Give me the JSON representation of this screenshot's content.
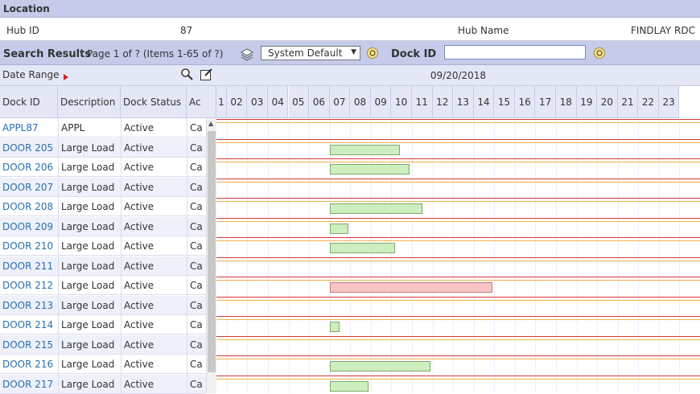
{
  "location": {
    "header": "Location"
  },
  "hub": {
    "id_label": "Hub ID",
    "id_value": "87",
    "name_label": "Hub Name",
    "name_value": "FINDLAY RDC"
  },
  "search": {
    "title": "Search Results",
    "page_info": "Page 1 of ? (Items 1-65 of ?)",
    "view_select": "System Default",
    "dock_id_label": "Dock ID",
    "dock_id_value": ""
  },
  "daterange": {
    "label": "Date Range",
    "date": "09/20/2018"
  },
  "columns": {
    "dock_id": "Dock ID",
    "description": "Description",
    "dock_status": "Dock Status",
    "ac": "Ac"
  },
  "hours": [
    "1",
    "02",
    "03",
    "04",
    "05",
    "06",
    "07",
    "08",
    "09",
    "10",
    "11",
    "12",
    "13",
    "14",
    "15",
    "16",
    "17",
    "18",
    "19",
    "20",
    "21",
    "22",
    "23"
  ],
  "rows": [
    {
      "id": "APPL87",
      "desc": "APPL",
      "status": "Active",
      "ac": "Ca"
    },
    {
      "id": "DOOR 205",
      "desc": "Large Load",
      "status": "Active",
      "ac": "Ca"
    },
    {
      "id": "DOOR 206",
      "desc": "Large Load",
      "status": "Active",
      "ac": "Ca"
    },
    {
      "id": "DOOR 207",
      "desc": "Large Load",
      "status": "Active",
      "ac": "Ca"
    },
    {
      "id": "DOOR 208",
      "desc": "Large Load",
      "status": "Active",
      "ac": "Ca"
    },
    {
      "id": "DOOR 209",
      "desc": "Large Load",
      "status": "Active",
      "ac": "Ca"
    },
    {
      "id": "DOOR 210",
      "desc": "Large Load",
      "status": "Active",
      "ac": "Ca"
    },
    {
      "id": "DOOR 211",
      "desc": "Large Load",
      "status": "Active",
      "ac": "Ca"
    },
    {
      "id": "DOOR 212",
      "desc": "Large Load",
      "status": "Active",
      "ac": "Ca"
    },
    {
      "id": "DOOR 213",
      "desc": "Large Load",
      "status": "Active",
      "ac": "Ca"
    },
    {
      "id": "DOOR 214",
      "desc": "Large Load",
      "status": "Active",
      "ac": "Ca"
    },
    {
      "id": "DOOR 215",
      "desc": "Large Load",
      "status": "Active",
      "ac": "Ca"
    },
    {
      "id": "DOOR 216",
      "desc": "Large Load",
      "status": "Active",
      "ac": "Ca"
    },
    {
      "id": "DOOR 217",
      "desc": "Large Load",
      "status": "Active",
      "ac": "Ca"
    }
  ],
  "colors": {
    "accent_header": "#c5cbe9",
    "link": "#2a6fb0",
    "booking_ok": "#cdeebf",
    "booking_alert": "#f8c4c4",
    "line_red": "#d63a3a",
    "line_orange": "#f0b04a"
  },
  "icons": [
    "layers-icon",
    "refresh-icon",
    "search-zoom-icon",
    "edit-icon",
    "arrow-right-icon",
    "chevron-down-icon"
  ]
}
